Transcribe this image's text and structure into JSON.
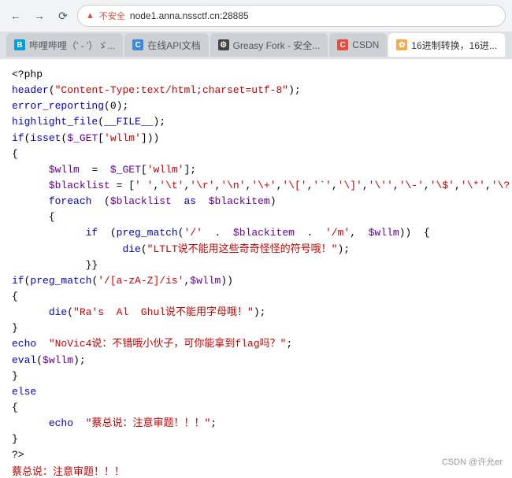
{
  "browser": {
    "url": "node1.anna.nssctf.cn:28885",
    "security_text": "不安全",
    "security_symbol": "▲"
  },
  "tabs": [
    {
      "id": "tab1",
      "label": "哔哩哔哩（' - '）ゞ...",
      "icon_color": "#00a1d6",
      "icon_text": "哔",
      "active": false
    },
    {
      "id": "tab2",
      "label": "在线API文档",
      "icon_color": "#3d8bd5",
      "icon_text": "C",
      "active": false
    },
    {
      "id": "tab3",
      "label": "Greasy Fork - 安全...",
      "icon_color": "#555",
      "icon_text": "G",
      "active": false
    },
    {
      "id": "tab4",
      "label": "CSDN",
      "icon_color": "#e74c3c",
      "icon_text": "C",
      "active": false
    },
    {
      "id": "tab5",
      "label": "16进制转换，16进...",
      "icon_color": "#f39c12",
      "icon_text": "✿",
      "active": false
    }
  ],
  "watermark": "CSDN @许允er"
}
